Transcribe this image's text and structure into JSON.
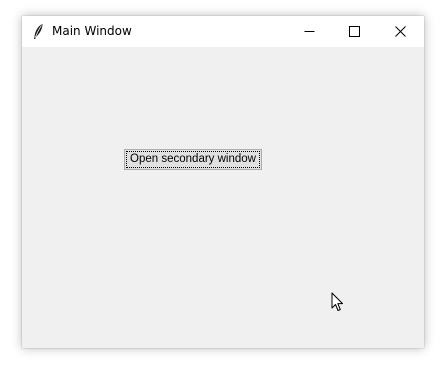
{
  "window": {
    "title": "Main Window",
    "app_icon": "feather-icon",
    "controls": {
      "minimize_icon": "minimize-icon",
      "maximize_icon": "maximize-icon",
      "close_icon": "close-icon"
    }
  },
  "main": {
    "open_button_label": "Open secondary window"
  },
  "cursor_icon": "mouse-pointer-icon",
  "colors": {
    "titlebar_bg": "#ffffff",
    "client_bg": "#f0f0f0",
    "button_bg": "#e1e1e1",
    "button_border": "#adadad"
  }
}
